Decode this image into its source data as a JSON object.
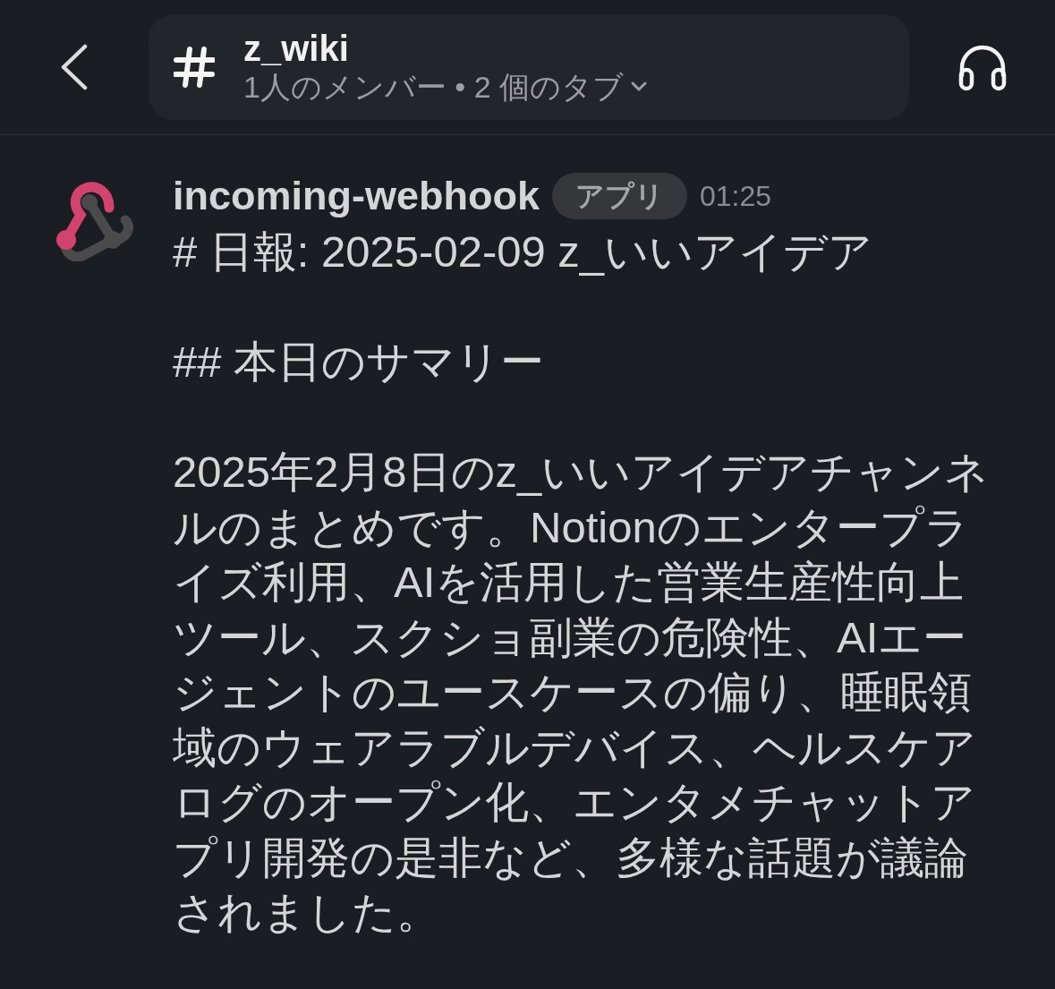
{
  "header": {
    "title": "z_wiki",
    "subtitle": "1人のメンバー • 2 個のタブ"
  },
  "message": {
    "sender": "incoming-webhook",
    "badge": "アプリ",
    "time": "01:25",
    "paragraphs": [
      "# 日報: 2025-02-09 z_いいアイデア",
      "## 本日のサマリー",
      "2025年2月8日のz_いいアイデアチャンネルのまとめです。Notionのエンタープライズ利用、AIを活用した営業生産性向上ツール、スクショ副業の危険性、AIエージェントのユースケースの偏り、睡眠領域のウェアラブルデバイス、ヘルスケアログのオープン化、エンタメチャットアプリ開発の是非など、多様な話題が議論されました。"
    ]
  }
}
